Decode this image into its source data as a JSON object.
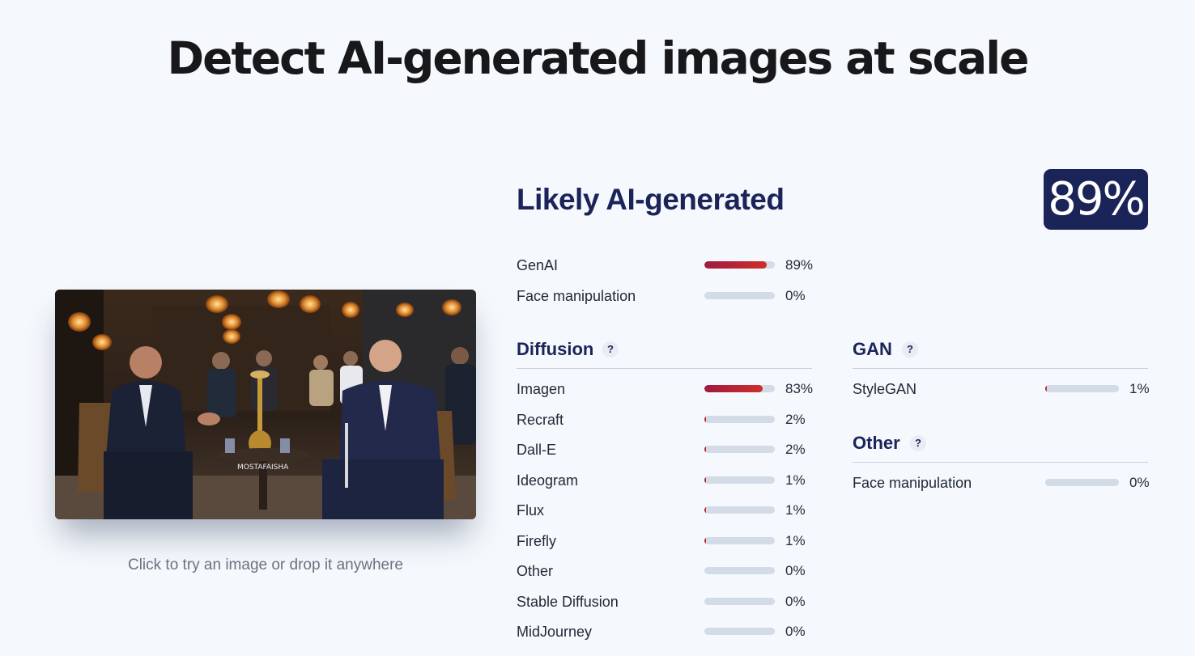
{
  "page": {
    "title": "Detect AI-generated images at scale",
    "drop_hint": "Click to try an image or drop it anywhere"
  },
  "image": {
    "watermark": "MOSTAFAISHA"
  },
  "result": {
    "verdict": "Likely AI-generated",
    "score_text": "89%",
    "accent_color": "#1b2459",
    "bar_fill_colors": [
      "#9e1b42",
      "#d02f2a"
    ],
    "bar_track_color": "#d3dbe6"
  },
  "summary": [
    {
      "label": "GenAI",
      "value": 89,
      "text": "89%"
    },
    {
      "label": "Face manipulation",
      "value": 0,
      "text": "0%"
    }
  ],
  "diffusion": {
    "title": "Diffusion",
    "help": "?",
    "items": [
      {
        "label": "Imagen",
        "value": 83,
        "text": "83%"
      },
      {
        "label": "Recraft",
        "value": 2,
        "text": "2%"
      },
      {
        "label": "Dall-E",
        "value": 2,
        "text": "2%"
      },
      {
        "label": "Ideogram",
        "value": 1,
        "text": "1%"
      },
      {
        "label": "Flux",
        "value": 1,
        "text": "1%"
      },
      {
        "label": "Firefly",
        "value": 1,
        "text": "1%"
      },
      {
        "label": "Other",
        "value": 0,
        "text": "0%"
      },
      {
        "label": "Stable Diffusion",
        "value": 0,
        "text": "0%"
      },
      {
        "label": "MidJourney",
        "value": 0,
        "text": "0%"
      }
    ]
  },
  "gan": {
    "title": "GAN",
    "help": "?",
    "items": [
      {
        "label": "StyleGAN",
        "value": 1,
        "text": "1%"
      }
    ]
  },
  "other": {
    "title": "Other",
    "help": "?",
    "items": [
      {
        "label": "Face manipulation",
        "value": 0,
        "text": "0%"
      }
    ]
  }
}
